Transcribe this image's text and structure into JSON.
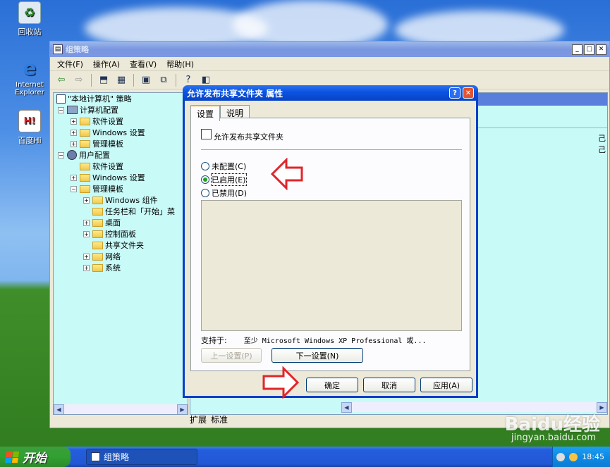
{
  "desktop": {
    "icons": [
      {
        "label": "回收站"
      },
      {
        "label": "Internet Explorer"
      },
      {
        "label": "百度Hi"
      }
    ]
  },
  "main_window": {
    "title": "组策略",
    "menu": [
      "文件(F)",
      "操作(A)",
      "查看(V)",
      "帮助(H)"
    ],
    "tree": {
      "root": "\"本地计算机\" 策略",
      "computer_config": "计算机配置",
      "computer_children": [
        "软件设置",
        "Windows 设置",
        "管理模板"
      ],
      "user_config": "用户配置",
      "user_children": [
        "软件设置",
        "Windows 设置",
        "管理模板"
      ],
      "admin_template_children": [
        "Windows 组件",
        "任务栏和「开始」菜",
        "桌面",
        "控制面板",
        "共享文件夹",
        "网络",
        "系统"
      ]
    },
    "right_side_fragments": [
      "己",
      "己"
    ],
    "bottom_tabs": [
      "扩展",
      "标准"
    ]
  },
  "dialog": {
    "title": "允许发布共享文件夹 属性",
    "tabs": [
      "设置",
      "说明"
    ],
    "policy_name": "允许发布共享文件夹",
    "options": [
      {
        "label": "未配置(C)",
        "selected": false
      },
      {
        "label": "已启用(E)",
        "selected": true
      },
      {
        "label": "已禁用(D)",
        "selected": false
      }
    ],
    "supported_label": "支持于:",
    "supported_value": "至少 Microsoft Windows XP Professional 或...",
    "prev_button": "上一设置(P)",
    "next_button": "下一设置(N)",
    "ok_button": "确定",
    "cancel_button": "取消",
    "apply_button": "应用(A)"
  },
  "taskbar": {
    "start_label": "开始",
    "task_label": "组策略",
    "clock": "18:45"
  },
  "watermark": {
    "brand": "Baidu经验",
    "url": "jingyan.baidu.com"
  },
  "colors": {
    "pane_bg": "#c8faf8",
    "dialog_border": "#0b3ec9",
    "annotation_arrow": "#e0262b"
  }
}
